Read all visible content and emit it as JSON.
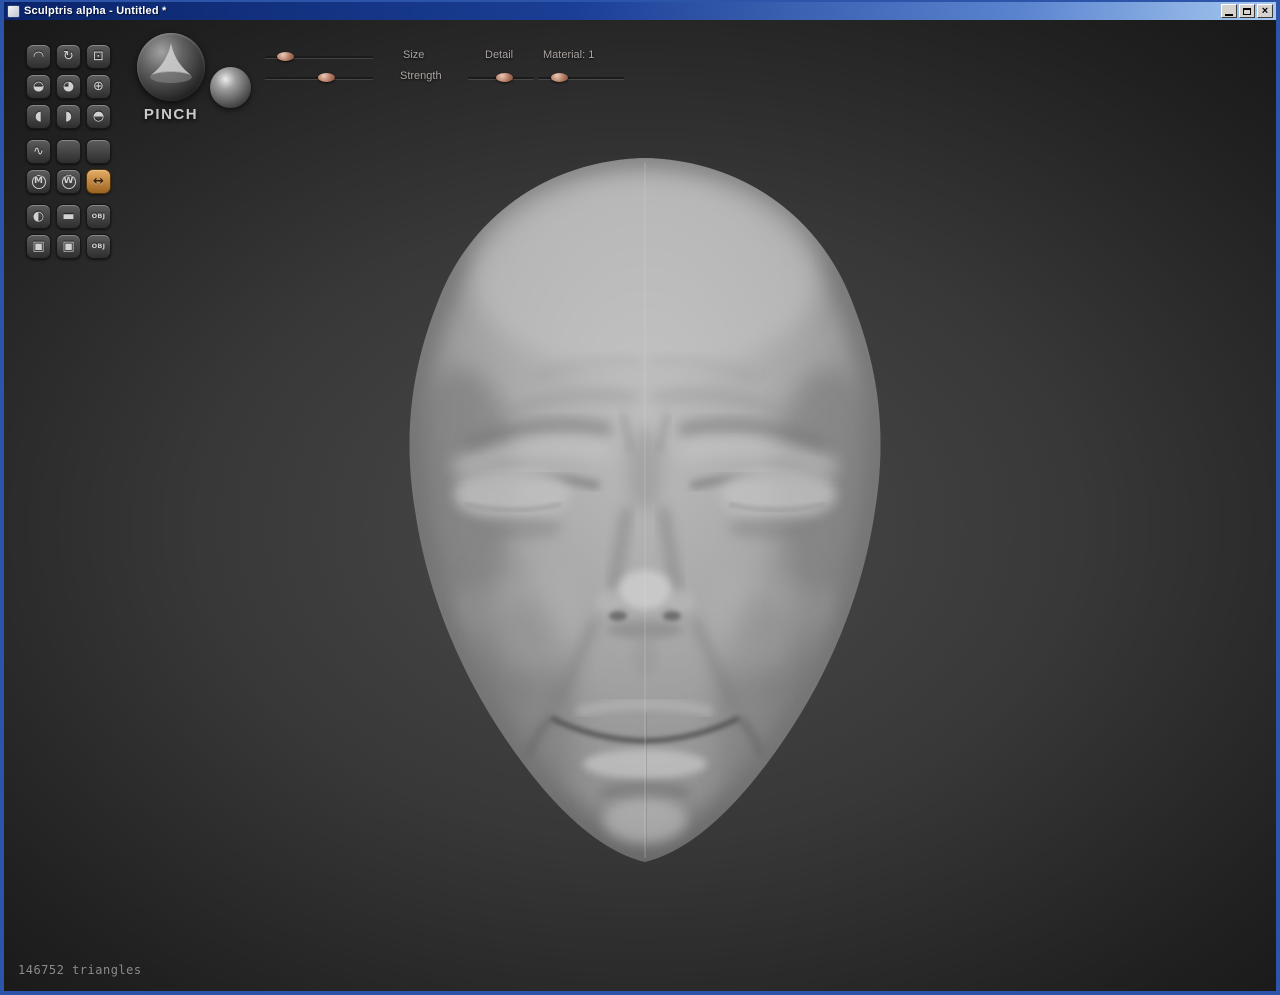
{
  "window": {
    "title": "Sculptris alpha - Untitled *",
    "close_glyph": "×"
  },
  "toolbar": {
    "buttons": [
      {
        "id": "draw",
        "glyph": "◠"
      },
      {
        "id": "rotate",
        "glyph": "↻"
      },
      {
        "id": "scale",
        "glyph": "⊡"
      },
      {
        "id": "flatten",
        "glyph": "◒"
      },
      {
        "id": "inflate",
        "glyph": "◕"
      },
      {
        "id": "grab",
        "glyph": "⊕"
      },
      {
        "id": "smooth",
        "glyph": "◖"
      },
      {
        "id": "crease",
        "glyph": "◗"
      },
      {
        "id": "pinch",
        "glyph": "◓"
      },
      {
        "id": "reduce",
        "glyph": "∿"
      },
      {
        "id": "brush-a",
        "glyph": ""
      },
      {
        "id": "brush-b",
        "glyph": ""
      },
      {
        "id": "mask",
        "glyph": "M"
      },
      {
        "id": "wireframe",
        "glyph": "W"
      },
      {
        "id": "symmetry",
        "glyph": "↔",
        "active": true
      },
      {
        "id": "new-sphere",
        "glyph": "◐"
      },
      {
        "id": "new-plane",
        "glyph": "▬"
      },
      {
        "id": "import-obj",
        "glyph": "OBJ"
      },
      {
        "id": "save",
        "glyph": "▣"
      },
      {
        "id": "save-as",
        "glyph": "▣"
      },
      {
        "id": "export-obj",
        "glyph": "OBJ"
      }
    ]
  },
  "brush": {
    "tool_label": "PINCH"
  },
  "sliders": {
    "size": {
      "label": "Size",
      "handle_style": "left:12px"
    },
    "strength": {
      "label": "Strength",
      "handle_style": "left:53px"
    },
    "detail": {
      "label": "Detail",
      "handle_style": "left:28px"
    },
    "material": {
      "label": "Material: 1",
      "handle_style": "left:13px"
    }
  },
  "status": {
    "triangles": "146752 triangles"
  }
}
